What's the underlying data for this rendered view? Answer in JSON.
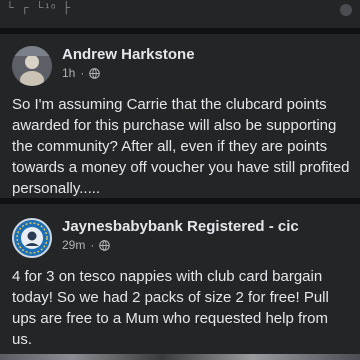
{
  "top_fragment": "└ ┌ └¹ᵒ ├",
  "posts": [
    {
      "author": "Andrew Harkstone",
      "time": "1h",
      "body": "So I'm assuming Carrie that the clubcard points awarded for this purchase will also be supporting the community?  After all, even if they are points towards a money off voucher you have still profited personally....."
    },
    {
      "author": "Jaynesbabybank Registered - cic",
      "time": "29m",
      "body": "4 for 3 on tesco nappies with club card bargain today! So we had 2 packs of size 2 for free! Pull ups are free to a Mum who requested help from us."
    }
  ],
  "icons": {
    "globe": "globe-icon",
    "more": "more-options-icon"
  }
}
